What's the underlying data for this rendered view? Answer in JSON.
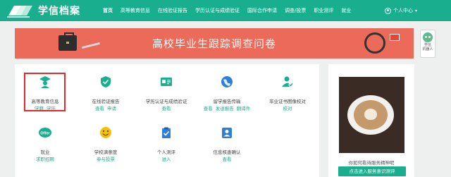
{
  "brand": {
    "name": "学信档案"
  },
  "nav": {
    "items": [
      "首页",
      "高等教育信息",
      "在线验证报告",
      "学历认证与成绩验证",
      "国际合作申请",
      "调查/投票",
      "职业测评",
      "就业"
    ],
    "active_index": 0,
    "user_menu": "个人中心"
  },
  "banner": {
    "title": "高校毕业生跟踪调查问卷"
  },
  "robot": {
    "line1": "学信",
    "line2": "机器人"
  },
  "services": [
    {
      "label": "高等教育信息",
      "links": [
        "学籍",
        "学历"
      ],
      "icon": "graduate-icon",
      "highlighted": true
    },
    {
      "label": "在线验证报告",
      "links": [
        "查看",
        "申请"
      ],
      "icon": "shield-check-icon"
    },
    {
      "label": "学历认证与成绩验证",
      "links": [
        "查看"
      ],
      "icon": "id-card-icon"
    },
    {
      "label": "留学报告传输",
      "links": [
        "查看",
        "发送报告",
        "翻译件"
      ],
      "icon": "globe-icon"
    },
    {
      "label": "毕业证书图像校对",
      "links": [
        "校对"
      ],
      "icon": "user-check-icon"
    },
    {
      "label": "就业",
      "links": [
        "求职招聘"
      ],
      "icon": "offer-icon"
    },
    {
      "label": "学校满意度",
      "links": [
        "参与投票"
      ],
      "icon": "smiley-icon"
    },
    {
      "label": "个人测评",
      "links": [
        "进入"
      ],
      "icon": "clipboard-check-icon"
    },
    {
      "label": "信息核查确认",
      "links": [
        "查看"
      ],
      "icon": "person-badge-icon"
    }
  ],
  "side_card": {
    "text": "你如何看待服务精神呢",
    "button": "点击进入服务意识测评"
  },
  "colors": {
    "brand": "#19ae8e",
    "banner": "#ec6a59",
    "highlight": "#e12b2b"
  }
}
